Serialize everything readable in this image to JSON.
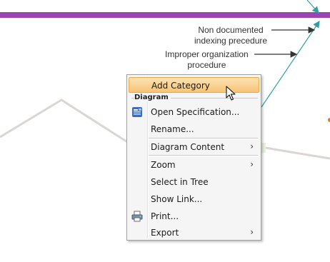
{
  "diagram": {
    "labels": {
      "non_documented": [
        "Non documented",
        "indexing precedure"
      ],
      "improper_org": [
        "Improper organization",
        "procedure"
      ]
    },
    "colors": {
      "band": "#9b45b3",
      "teal": "#2f9f9f",
      "gray_line": "#d9d6d3",
      "arrow": "#333333"
    }
  },
  "context_menu": {
    "items": [
      {
        "label": "Add Category",
        "highlighted": true
      },
      {
        "group_header": "Diagram"
      },
      {
        "label": "Open Specification...",
        "icon": "specification-icon"
      },
      {
        "label": "Rename..."
      },
      {
        "label": "Diagram Content",
        "submenu": true
      },
      {
        "label": "Zoom",
        "submenu": true
      },
      {
        "label": "Select in Tree"
      },
      {
        "label": "Show Link..."
      },
      {
        "label": "Print...",
        "icon": "printer-icon"
      },
      {
        "label": "Export",
        "submenu": true
      }
    ],
    "submenu_glyph": "›"
  }
}
